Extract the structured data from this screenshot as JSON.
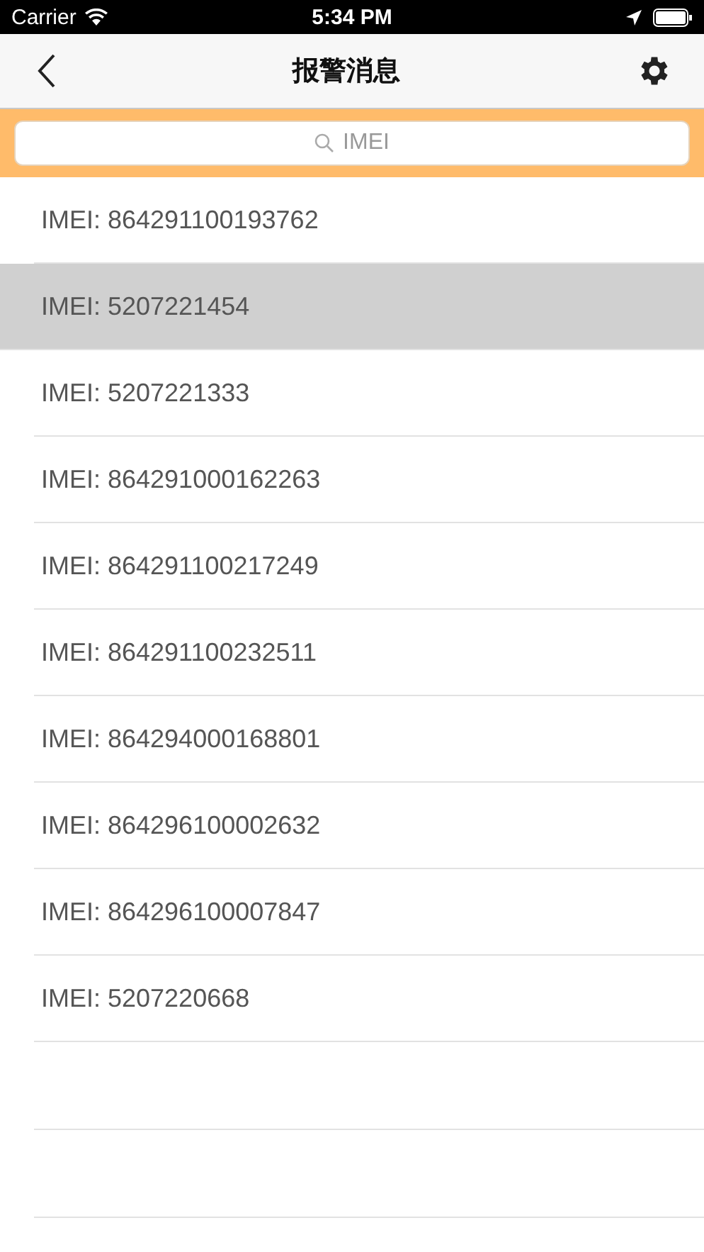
{
  "status_bar": {
    "carrier": "Carrier",
    "time": "5:34 PM"
  },
  "nav": {
    "title": "报警消息"
  },
  "search": {
    "placeholder": "IMEI"
  },
  "rows": [
    {
      "label": "IMEI: 864291100193762",
      "selected": false
    },
    {
      "label": "IMEI: 5207221454",
      "selected": true
    },
    {
      "label": "IMEI: 5207221333",
      "selected": false
    },
    {
      "label": "IMEI: 864291000162263",
      "selected": false
    },
    {
      "label": "IMEI: 864291100217249",
      "selected": false
    },
    {
      "label": "IMEI: 864291100232511",
      "selected": false
    },
    {
      "label": "IMEI: 864294000168801",
      "selected": false
    },
    {
      "label": "IMEI: 864296100002632",
      "selected": false
    },
    {
      "label": "IMEI: 864296100007847",
      "selected": false
    },
    {
      "label": "IMEI: 5207220668",
      "selected": false
    }
  ]
}
